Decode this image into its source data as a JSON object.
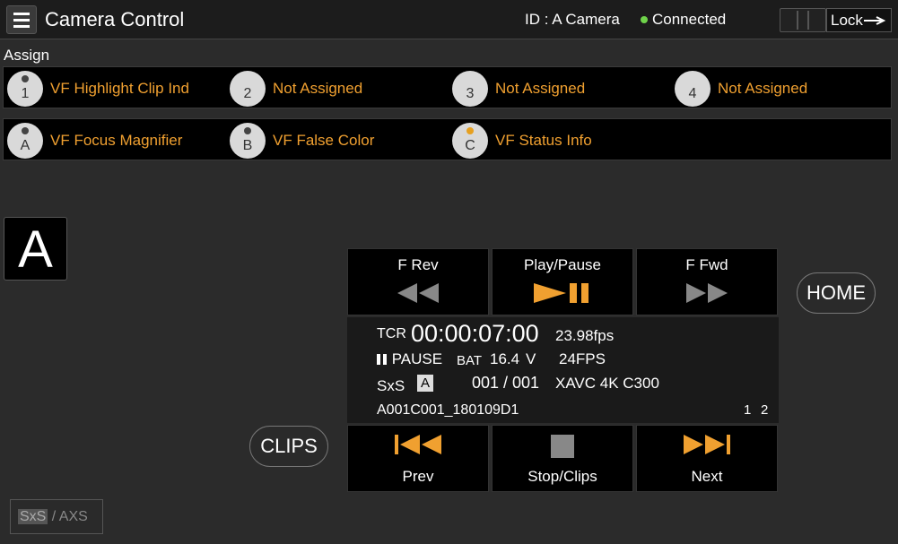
{
  "header": {
    "title": "Camera Control",
    "camera_id": "ID : A Camera",
    "connection_status": "Connected",
    "lock_label": "Lock"
  },
  "assign": {
    "label": "Assign",
    "row1": [
      {
        "key": "1",
        "name": "VF Highlight Clip Ind",
        "led": "off"
      },
      {
        "key": "2",
        "name": "Not Assigned",
        "led": "none"
      },
      {
        "key": "3",
        "name": "Not Assigned",
        "led": "none"
      },
      {
        "key": "4",
        "name": "Not Assigned",
        "led": "none"
      }
    ],
    "row2": [
      {
        "key": "A",
        "name": "VF Focus Magnifier",
        "led": "off"
      },
      {
        "key": "B",
        "name": "VF False Color",
        "led": "off"
      },
      {
        "key": "C",
        "name": "VF Status Info",
        "led": "on"
      }
    ]
  },
  "camera_badge": "A",
  "transport": {
    "rev_label": "F Rev",
    "play_label": "Play/Pause",
    "fwd_label": "F Fwd",
    "prev_label": "Prev",
    "stop_label": "Stop/Clips",
    "next_label": "Next",
    "home_label": "HOME",
    "clips_label": "CLIPS"
  },
  "status": {
    "tc_label": "TCR",
    "timecode": "00:00:07:00",
    "frame_rate": "23.98fps",
    "state": "PAUSE",
    "bat_label": "BAT",
    "battery": "16.4",
    "battery_unit": "V",
    "rec_fps": "24FPS",
    "media": "SxS",
    "slot": "A",
    "clip_count": "001 / 001",
    "codec": "XAVC 4K C300",
    "clip_name": "A001C001_180109D1",
    "page_1": "1",
    "page_2": "2"
  },
  "media_toggle": {
    "sxs": "SxS",
    "sep": " / ",
    "axs": "AXS"
  },
  "colors": {
    "accent_orange": "#f0a030",
    "connected_green": "#6fd34a",
    "background": "#2b2b2b"
  }
}
